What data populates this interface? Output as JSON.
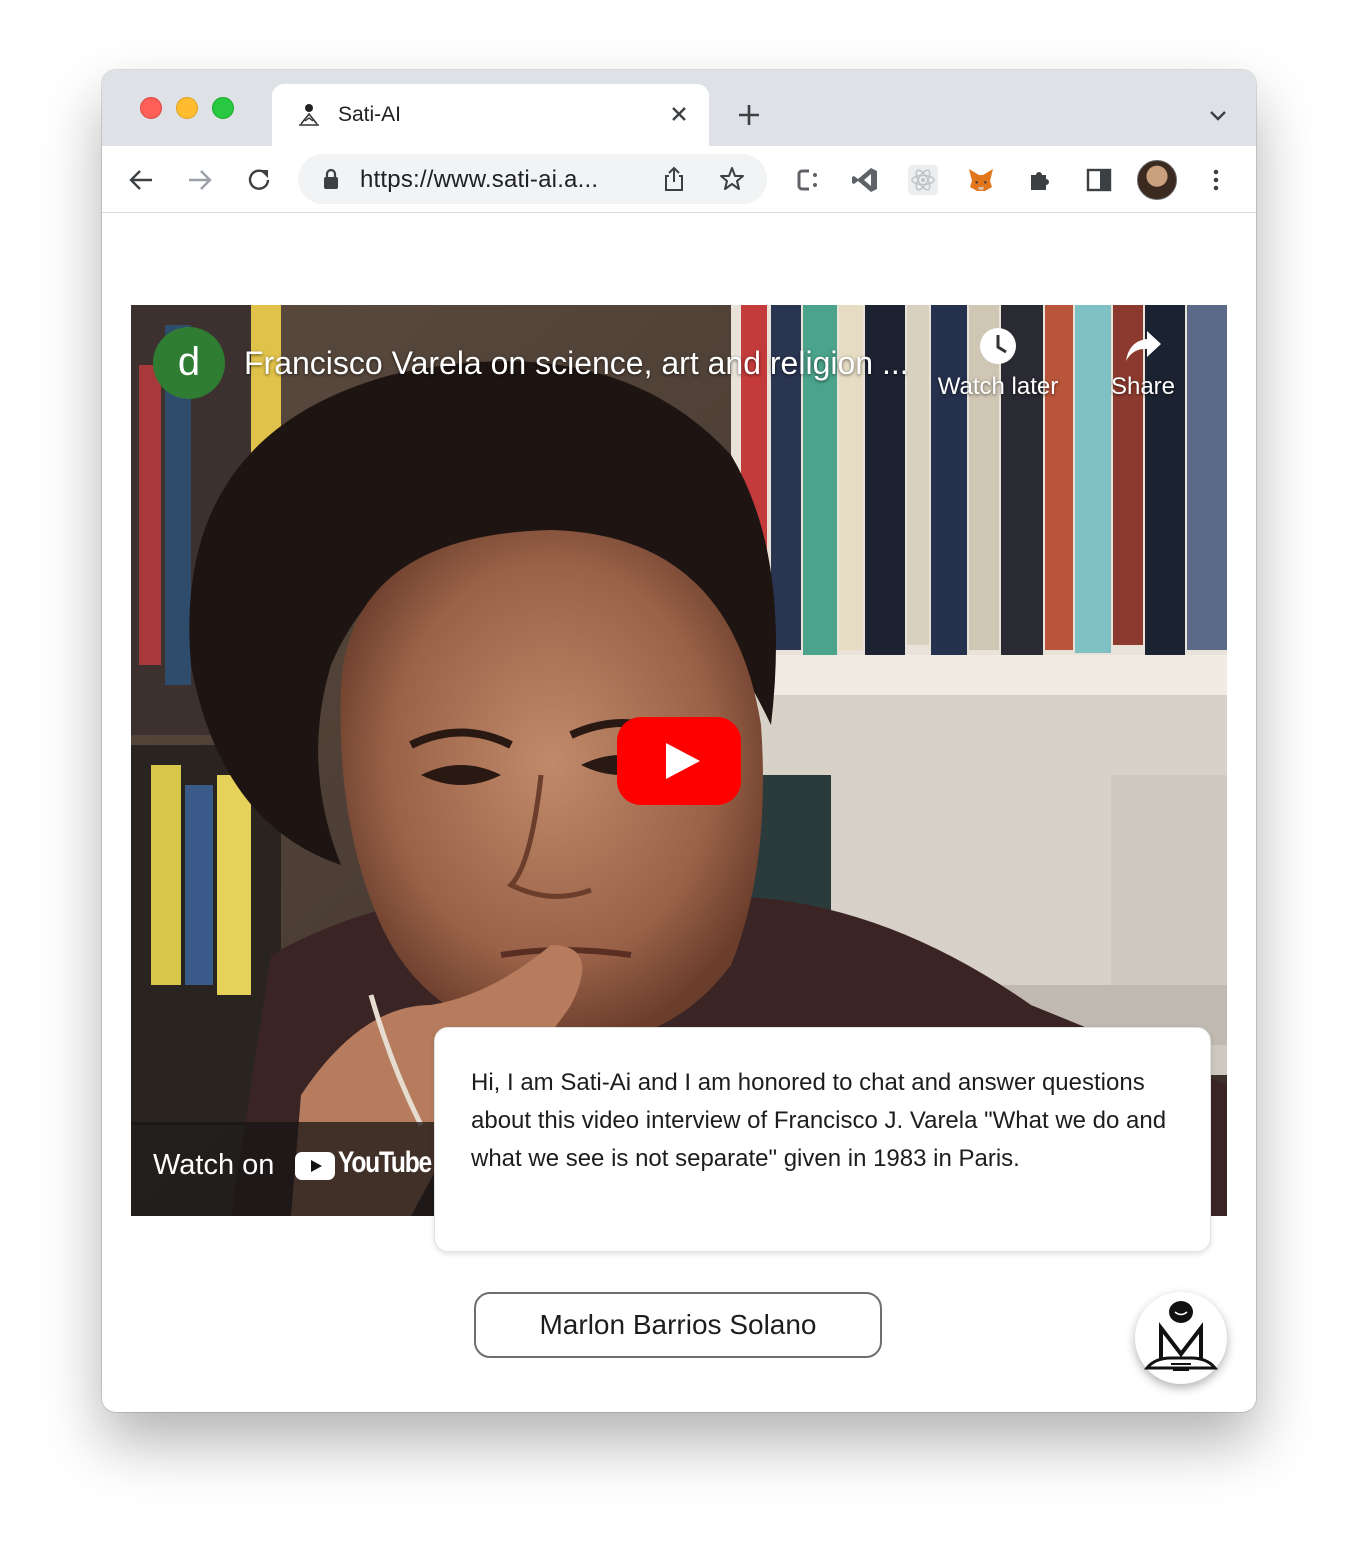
{
  "browser": {
    "tab_title": "Sati-AI",
    "url": "https://www.sati-ai.a...",
    "icons": [
      "back-icon",
      "forward-icon",
      "reload-icon",
      "lock-icon",
      "share-icon",
      "star-icon",
      "extension-icons",
      "profile-avatar",
      "menu-icon"
    ]
  },
  "video": {
    "channel_initial": "d",
    "title": "Francisco Varela on science, art and religion ...",
    "watch_later_label": "Watch later",
    "share_label": "Share",
    "watch_on_label": "Watch on",
    "youtube_label": "YouTube",
    "colors": {
      "play": "#ff0000",
      "channel_avatar": "#2f7d32"
    }
  },
  "chat": {
    "message": "Hi, I am Sati-Ai and I am honored to chat and answer questions about this video interview of Francisco J. Varela \"What we do and what we see is not separate\" given in 1983 in Paris."
  },
  "footer": {
    "name_button": "Marlon Barrios Solano"
  }
}
